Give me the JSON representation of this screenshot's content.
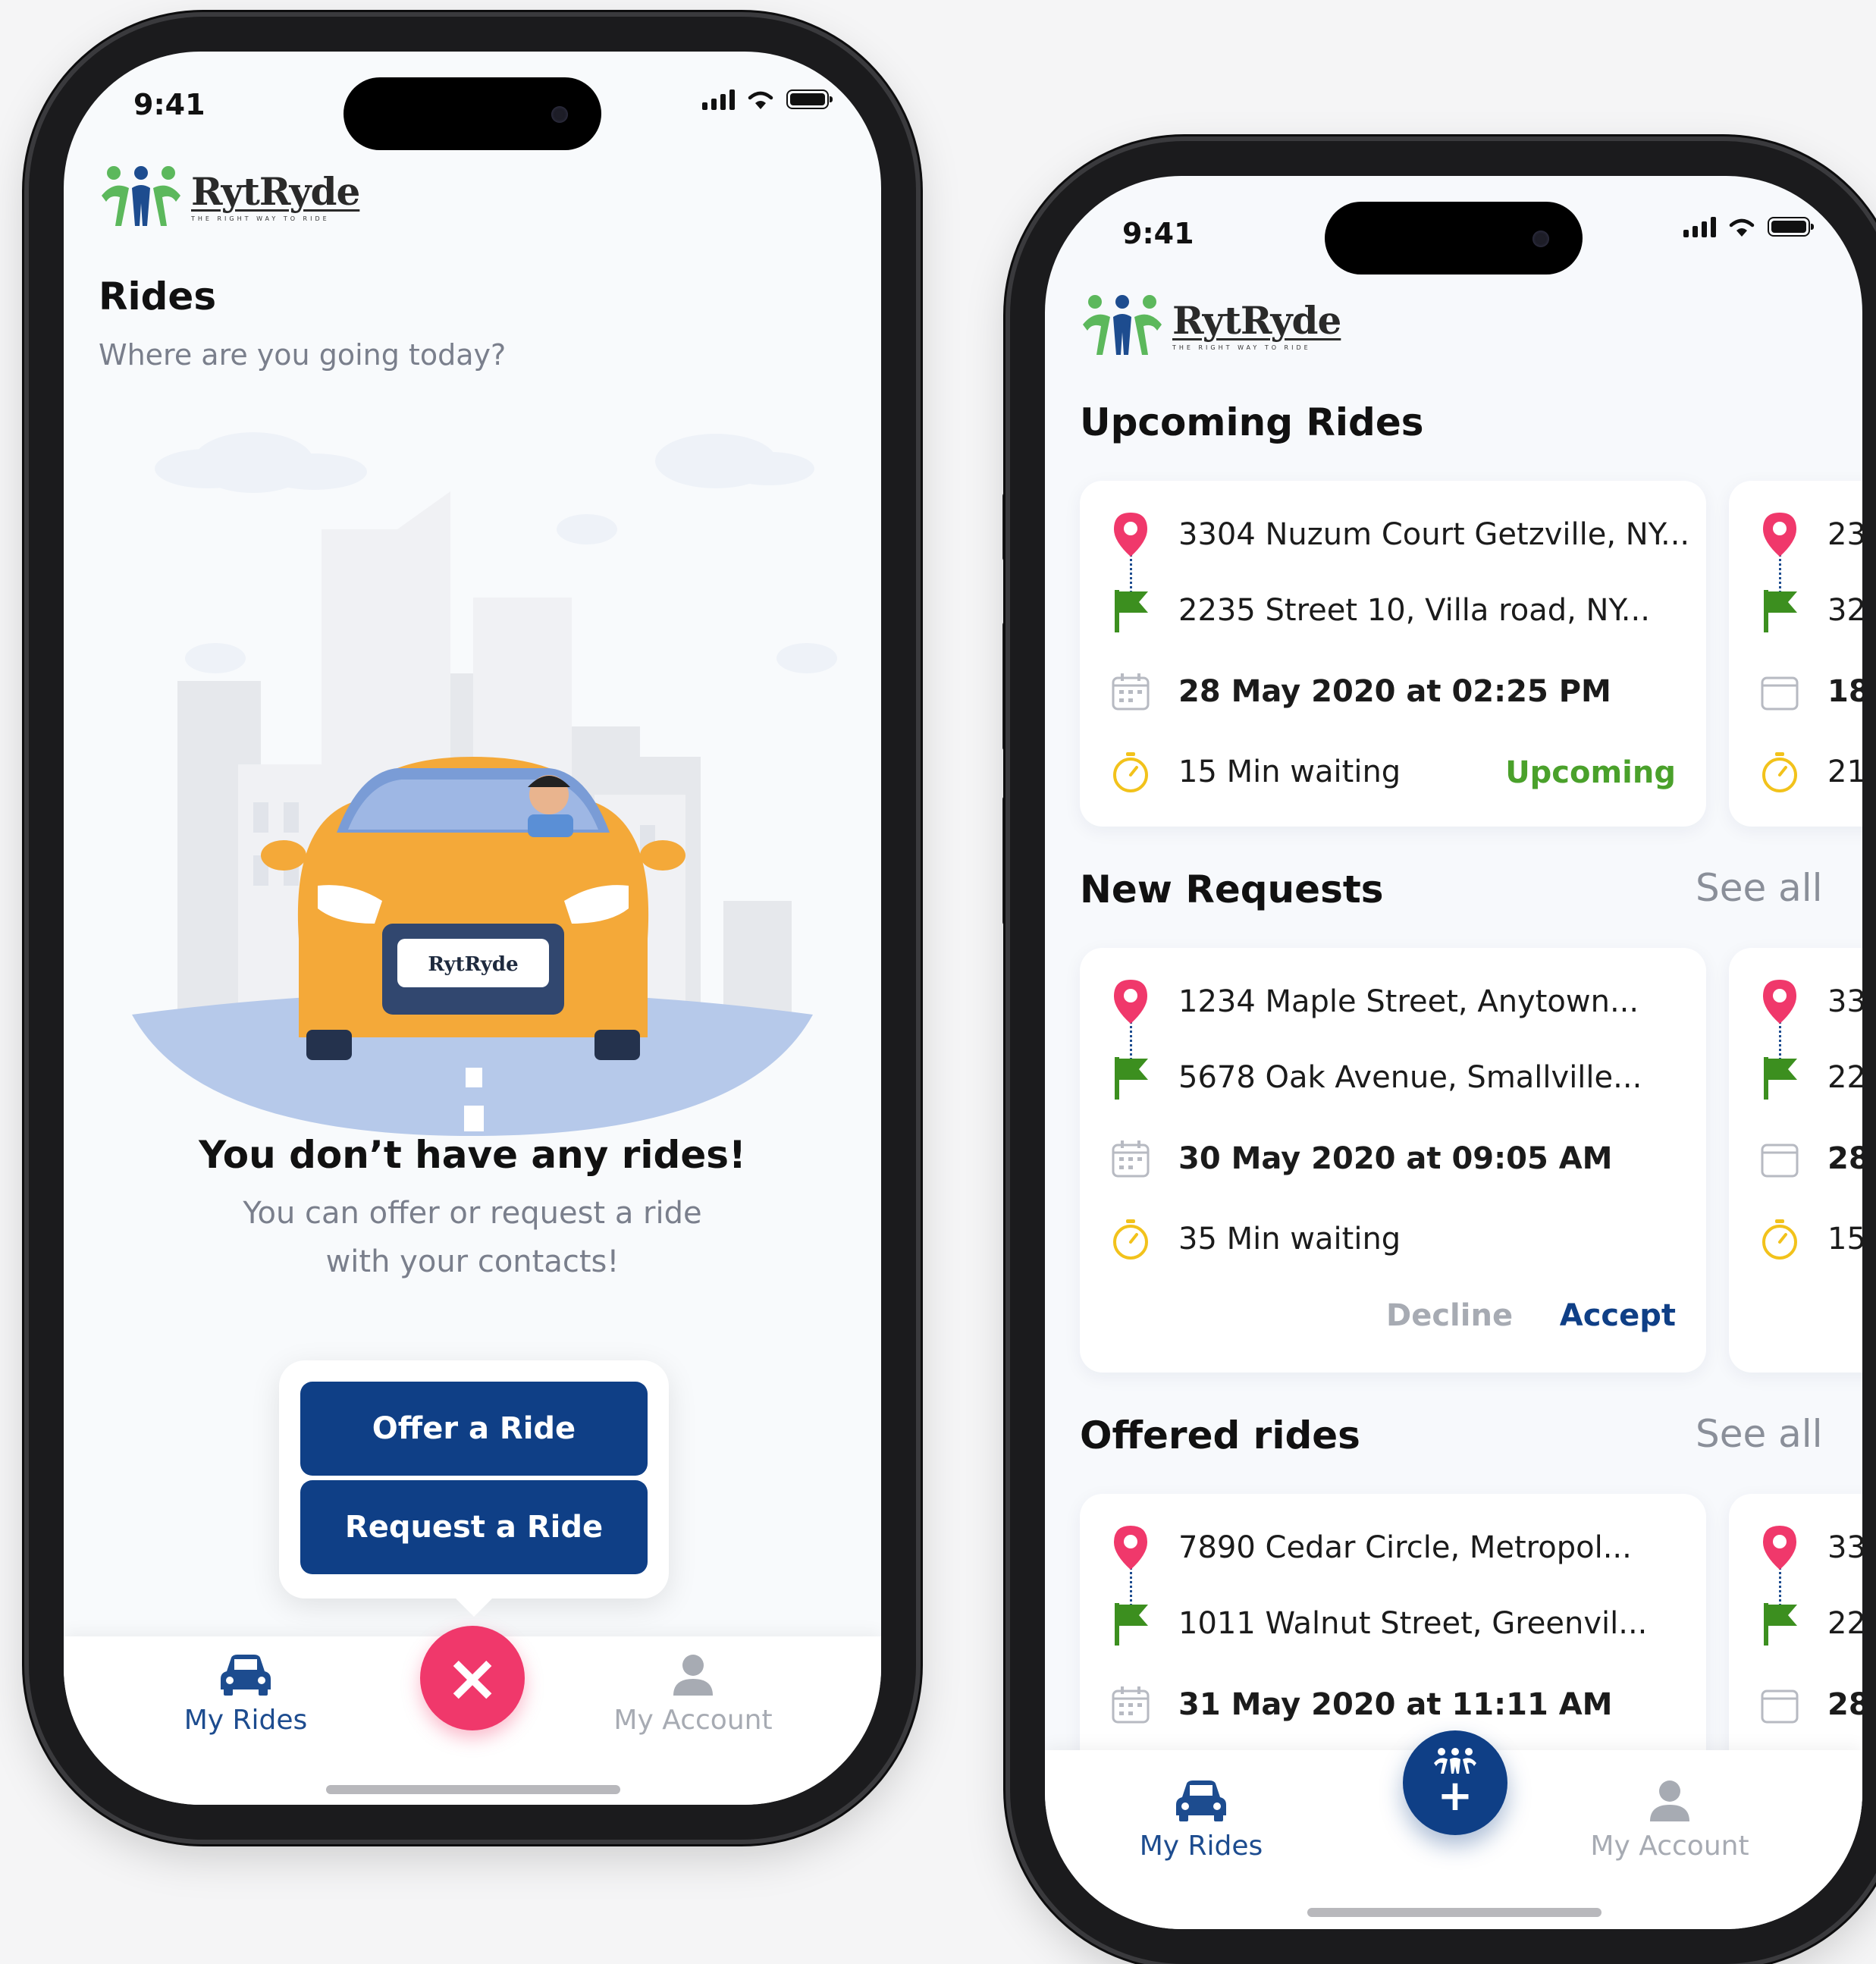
{
  "left_phone": {
    "status": {
      "time": "9:41"
    },
    "brand": {
      "name": "RytRyde",
      "tagline": "THE RIGHT WAY TO RIDE"
    },
    "header": {
      "title": "Rides",
      "subtitle": "Where are you going today?"
    },
    "illustration": {
      "plate_text": "RytRyde"
    },
    "empty_state": {
      "title": "You don’t have any rides!",
      "text_line1": "You can offer or request a ride",
      "text_line2": "with your contacts!"
    },
    "popup": {
      "offer_label": "Offer a Ride",
      "request_label": "Request a Ride"
    },
    "nav": {
      "my_rides": "My Rides",
      "my_account": "My Account",
      "fab_glyph": "×"
    }
  },
  "right_phone": {
    "status": {
      "time": "9:41"
    },
    "brand": {
      "name": "RytRyde",
      "tagline": "THE RIGHT WAY TO RIDE"
    },
    "upcoming": {
      "title": "Upcoming Rides",
      "card": {
        "from": "3304 Nuzum Court Getzville, NY...",
        "to": "2235 Street 10, Villa road, NY...",
        "datetime": "28 May 2020 at 02:25 PM",
        "waiting": "15 Min waiting",
        "status": "Upcoming"
      },
      "peek": {
        "from": "23",
        "to": "32",
        "datetime": "18",
        "waiting": "21"
      }
    },
    "new_requests": {
      "title": "New Requests",
      "see_all": "See all",
      "card": {
        "from": "1234 Maple Street, Anytown...",
        "to": "5678 Oak Avenue, Smallville...",
        "datetime": "30 May 2020 at 09:05 AM",
        "waiting": "35 Min waiting",
        "decline": "Decline",
        "accept": "Accept"
      },
      "peek": {
        "from": "33",
        "to": "22",
        "datetime": "28",
        "waiting": "15"
      }
    },
    "offered": {
      "title": "Offered rides",
      "see_all": "See all",
      "card": {
        "from": "7890 Cedar Circle, Metropol...",
        "to": "1011 Walnut Street, Greenvil...",
        "datetime": "31 May 2020 at 11:11 AM"
      },
      "peek": {
        "from": "33",
        "to": "22",
        "datetime": "28"
      }
    },
    "nav": {
      "my_rides": "My Rides",
      "my_account": "My Account",
      "fab_glyph": "+"
    }
  },
  "colors": {
    "primary": "#0f3f86",
    "accent_pink": "#f0386b",
    "green": "#3c8f1f",
    "upcoming_green": "#4aa12b",
    "timer_yellow": "#f2c21b",
    "muted": "#7a7f8c"
  }
}
